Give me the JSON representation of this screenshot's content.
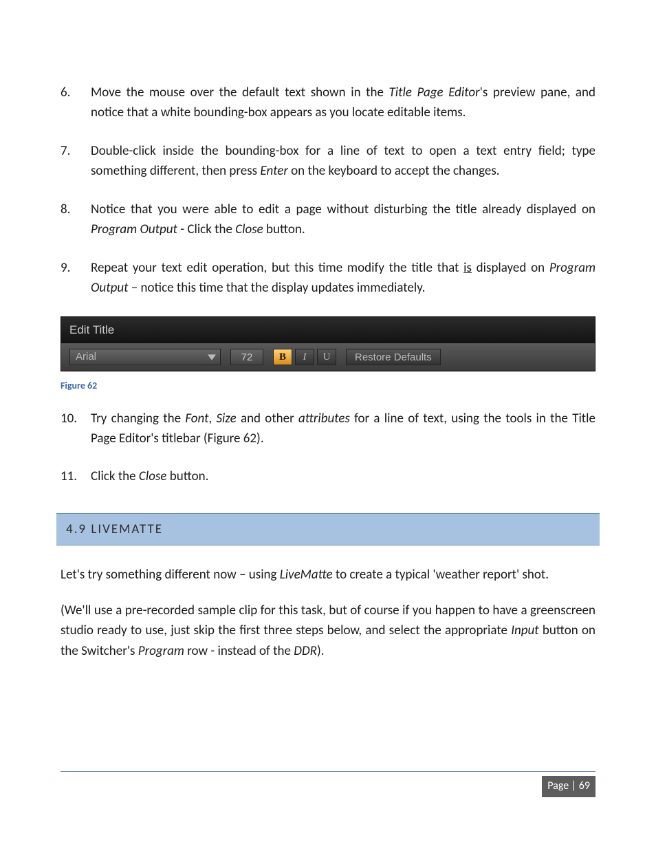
{
  "steps_a": [
    {
      "n": "6.",
      "html": "Move the mouse over the default text shown in the <span class='ital'>Title Page Editor</span>'s preview pane, and notice that a white bounding-box appears as you locate editable items."
    },
    {
      "n": "7.",
      "html": "Double-click inside the bounding-box for a line of text to open a text entry field; type something different, then press <span class='ital'>Enter</span> on the keyboard to accept the changes."
    },
    {
      "n": "8.",
      "html": "Notice that you were able to edit a page without disturbing the title already displayed on <span class='ital'>Program Output</span> - Click the <span class='ital'>Close</span> button."
    },
    {
      "n": "9.",
      "html": "Repeat your text edit operation, but this time modify the title that <span class='under'>is</span> displayed on <span class='ital'>Program Output</span> – notice this time that the display updates immediately."
    }
  ],
  "edit_title": {
    "header": "Edit Title",
    "font": "Arial",
    "size": "72",
    "b": "B",
    "i": "I",
    "u": "U",
    "restore": "Restore Defaults"
  },
  "figure_caption": "Figure 62",
  "steps_b": [
    {
      "n": "10.",
      "html": "Try changing the <span class='ital'>Font</span>, <span class='ital'>Size</span> and other <span class='ital'>attributes</span> for a line of text, using the tools in the Title Page Editor's titlebar (Figure 62)."
    },
    {
      "n": "11.",
      "html": "Click the <span class='ital'>Close</span> button."
    }
  ],
  "section": "4.9   LIVEMATTE",
  "para1_html": "Let's try something different now – using <span class='ital'>LiveMatte</span> to create a typical 'weather report' shot.",
  "para2_html": " (We'll use a pre-recorded sample clip for this task, but of course if you happen to have a greenscreen studio ready to use, just skip the first three steps below, and select the appropriate <span class='ital'>Input</span> button on the Switcher's <span class='ital'>Program</span> row - instead of the <span class='ital'>DDR</span>).",
  "page_label": "Page | 69"
}
